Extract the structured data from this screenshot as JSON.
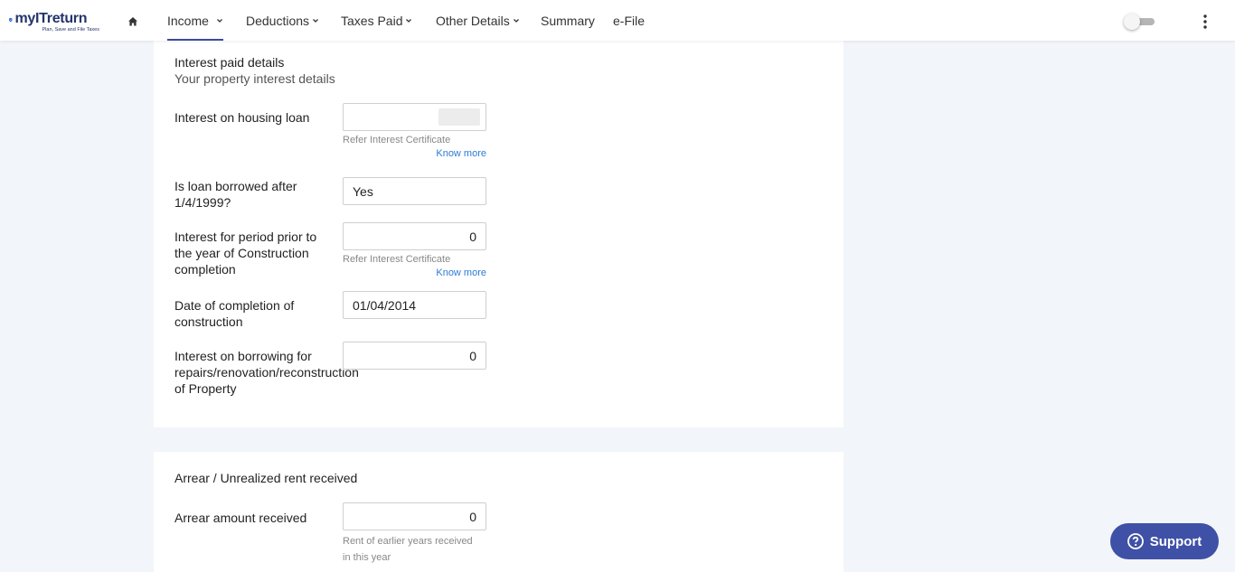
{
  "brand": {
    "logo_word": "myITreturn",
    "tagline": "Plan, Save and File Taxes",
    "color": "#24346b"
  },
  "nav": {
    "home_icon": "home-icon",
    "items": [
      {
        "label": "Income",
        "active": true,
        "has_dropdown": true
      },
      {
        "label": "Deductions",
        "has_dropdown": true
      },
      {
        "label": "Taxes Paid",
        "has_dropdown": true
      },
      {
        "label": "Other Details",
        "has_dropdown": true
      },
      {
        "label": "Summary",
        "has_dropdown": false
      },
      {
        "label": "e-File",
        "has_dropdown": false
      }
    ],
    "active_color": "#3c4b9b"
  },
  "interest_section": {
    "title": "Interest paid details",
    "subtitle": "Your property interest details",
    "housing_loan": {
      "label": "Interest on housing loan",
      "value": "",
      "helper": "Refer Interest Certificate",
      "know_more": "Know more"
    },
    "loan_after": {
      "label": "Is loan borrowed after 1/4/1999?",
      "value": "Yes"
    },
    "prior_period": {
      "label": "Interest for period prior to the year of Construction completion",
      "value": "0",
      "helper": "Refer Interest Certificate",
      "know_more": "Know more"
    },
    "completion_date": {
      "label": "Date of completion of construction",
      "value": "01/04/2014"
    },
    "repairs": {
      "label": "Interest on borrowing for repairs/renovation/reconstruction of Property",
      "value": "0"
    }
  },
  "arrear_section": {
    "title": "Arrear / Unrealized rent received",
    "arrear_amount": {
      "label": "Arrear amount received",
      "value": "0",
      "helper": "Rent of earlier years received in this year"
    }
  },
  "support": {
    "label": "Support",
    "icon": "question-circle-icon",
    "color": "#3f51a6"
  },
  "link_color": "#2b7bd6"
}
